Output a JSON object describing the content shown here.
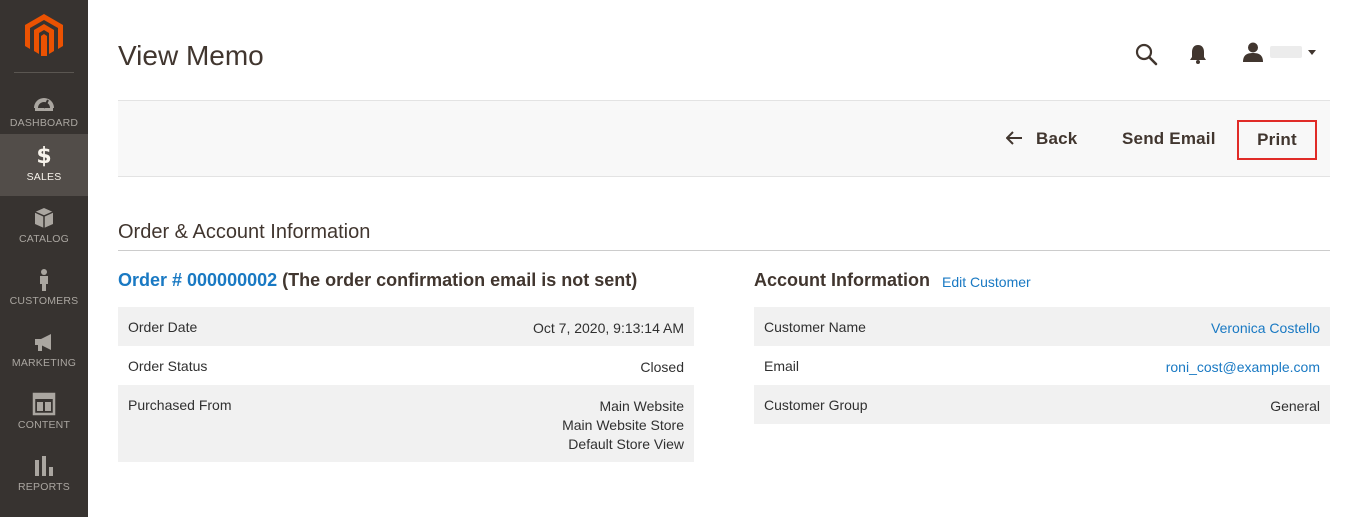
{
  "sidebar": {
    "items": [
      {
        "label": "Dashboard",
        "icon": "dashboard-icon"
      },
      {
        "label": "Sales",
        "icon": "dollar-icon",
        "active": true
      },
      {
        "label": "Catalog",
        "icon": "box-icon"
      },
      {
        "label": "Customers",
        "icon": "person-icon"
      },
      {
        "label": "Marketing",
        "icon": "megaphone-icon"
      },
      {
        "label": "Content",
        "icon": "layout-icon"
      },
      {
        "label": "Reports",
        "icon": "bar-chart-icon"
      }
    ],
    "dollar_symbol": "$"
  },
  "header": {
    "title": "View Memo"
  },
  "actions": {
    "back_label": "Back",
    "send_email_label": "Send Email",
    "print_label": "Print"
  },
  "section": {
    "title": "Order & Account Information"
  },
  "order": {
    "link_text": "Order # 000000002",
    "note": "(The order confirmation email is not sent)",
    "rows": [
      {
        "label": "Order Date",
        "value": "Oct 7, 2020, 9:13:14 AM"
      },
      {
        "label": "Order Status",
        "value": "Closed"
      },
      {
        "label": "Purchased From",
        "value_lines": [
          "Main Website",
          "Main Website Store",
          "Default Store View"
        ]
      }
    ]
  },
  "account": {
    "title": "Account Information",
    "edit_link": "Edit Customer",
    "rows": [
      {
        "label": "Customer Name",
        "value": "Veronica Costello"
      },
      {
        "label": "Email",
        "value": "roni_cost@example.com"
      },
      {
        "label": "Customer Group",
        "value": "General"
      }
    ]
  },
  "colors": {
    "brand_orange": "#eb5202",
    "sidebar_bg": "#373330",
    "link_blue": "#1979c3",
    "highlight_red": "#e02b27"
  }
}
